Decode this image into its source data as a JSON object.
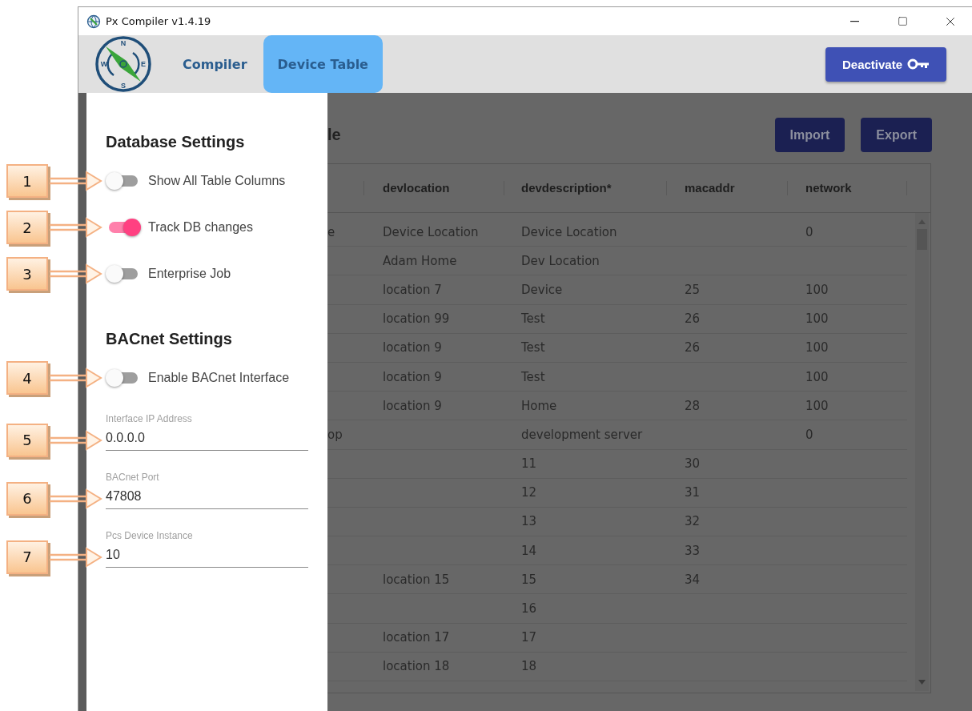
{
  "window": {
    "title": "Px Compiler v1.4.19"
  },
  "nav": {
    "logo_letters": [
      "N",
      "E",
      "S",
      "W"
    ],
    "tabs": [
      {
        "label": "Compiler",
        "selected": false
      },
      {
        "label": "Device Table",
        "selected": true
      }
    ],
    "deactivate_button": "Deactivate"
  },
  "settings_drawer": {
    "sections": [
      {
        "title": "Database Settings",
        "items": [
          {
            "kind": "switch",
            "label": "Show All Table Columns",
            "on": false,
            "callout": "1"
          },
          {
            "kind": "switch",
            "label": "Track DB changes",
            "on": true,
            "callout": "2"
          },
          {
            "kind": "switch",
            "label": "Enterprise Job",
            "on": false,
            "callout": "3"
          }
        ]
      },
      {
        "title": "BACnet Settings",
        "items": [
          {
            "kind": "switch",
            "label": "Enable BACnet Interface",
            "on": false,
            "callout": "4"
          },
          {
            "kind": "field",
            "label": "Interface IP Address",
            "value": "0.0.0.0",
            "callout": "5"
          },
          {
            "kind": "field",
            "label": "BACnet Port",
            "value": "47808",
            "callout": "6"
          },
          {
            "kind": "field",
            "label": "Pcs Device Instance",
            "value": "10",
            "callout": "7"
          }
        ]
      }
    ]
  },
  "content": {
    "title": "le",
    "buttons": [
      "Import",
      "Export"
    ],
    "table": {
      "columns": [
        "",
        "devlocation",
        "devdescription*",
        "macaddr",
        "network"
      ],
      "rows": [
        [
          "e",
          "Device Location",
          "Device Location",
          "",
          "0"
        ],
        [
          "",
          "Adam Home",
          "Dev Location",
          "",
          ""
        ],
        [
          "",
          "location 7",
          "Device",
          "25",
          "100"
        ],
        [
          "",
          "location 99",
          "Test",
          "26",
          "100"
        ],
        [
          "",
          "location 9",
          "Test",
          "26",
          "100"
        ],
        [
          "",
          "location 9",
          "Test",
          "",
          "100"
        ],
        [
          "",
          "location 9",
          "Home",
          "28",
          "100"
        ],
        [
          "op",
          "",
          "development server",
          "",
          "0"
        ],
        [
          "",
          "",
          "11",
          "30",
          ""
        ],
        [
          "",
          "",
          "12",
          "31",
          ""
        ],
        [
          "",
          "",
          "13",
          "32",
          ""
        ],
        [
          "",
          "",
          "14",
          "33",
          ""
        ],
        [
          "",
          "location 15",
          "15",
          "34",
          ""
        ],
        [
          "",
          "",
          "16",
          "",
          ""
        ],
        [
          "",
          "location 17",
          "17",
          "",
          ""
        ],
        [
          "",
          "location 18",
          "18",
          "",
          ""
        ]
      ]
    }
  }
}
